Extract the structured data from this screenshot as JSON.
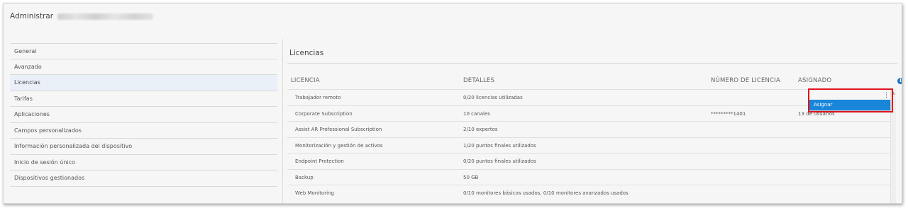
{
  "header": {
    "title": "Administrar"
  },
  "sidebar": {
    "items": [
      {
        "label": "General"
      },
      {
        "label": "Avanzado"
      },
      {
        "label": "Licencias"
      },
      {
        "label": "Tarifas"
      },
      {
        "label": "Aplicaciones"
      },
      {
        "label": "Campos personalizados"
      },
      {
        "label": "Información personalizada del dispositivo"
      },
      {
        "label": "Inicio de sesión único"
      },
      {
        "label": "Dispositivos gestionados"
      }
    ],
    "active": "Licencias"
  },
  "main": {
    "title": "Licencias",
    "columns": {
      "license": "LICENCIA",
      "details": "DETALLES",
      "license_number": "NÚMERO DE LICENCIA",
      "assigned": "ASIGNADO"
    },
    "rows": [
      {
        "license": "Trabajador remoto",
        "details": "0/20 licencias utilizadas",
        "number": "",
        "assigned": ""
      },
      {
        "license": "Corporate Subscription",
        "details": "10 canales",
        "number": "*********1401",
        "assigned": "13 de usuarios"
      },
      {
        "license": "Assist AR Professional Subscription",
        "details": "2/10 expertos",
        "number": "",
        "assigned": ""
      },
      {
        "license": "Monitorización y gestión de activos",
        "details": "1/20 puntos finales utilizados",
        "number": "",
        "assigned": ""
      },
      {
        "license": "Endpoint Protection",
        "details": "0/20 puntos finales utilizados",
        "number": "",
        "assigned": ""
      },
      {
        "license": "Backup",
        "details": "50 GB",
        "number": "",
        "assigned": ""
      },
      {
        "license": "Web Monitoring",
        "details": "0/10 monitores básicos usados, 0/10 monitores avanzados usados",
        "number": "",
        "assigned": ""
      }
    ],
    "row_menu": {
      "assign_label": "Asignar"
    }
  },
  "icons": {
    "info": "info-icon",
    "row_actions": "kebab-menu-icon",
    "scroll_up": "chevron-up-icon"
  },
  "colors": {
    "accent": "#1a86d9",
    "highlight": "#e0141d",
    "info": "#1f73c7",
    "active_row": "#e9f0f8"
  }
}
